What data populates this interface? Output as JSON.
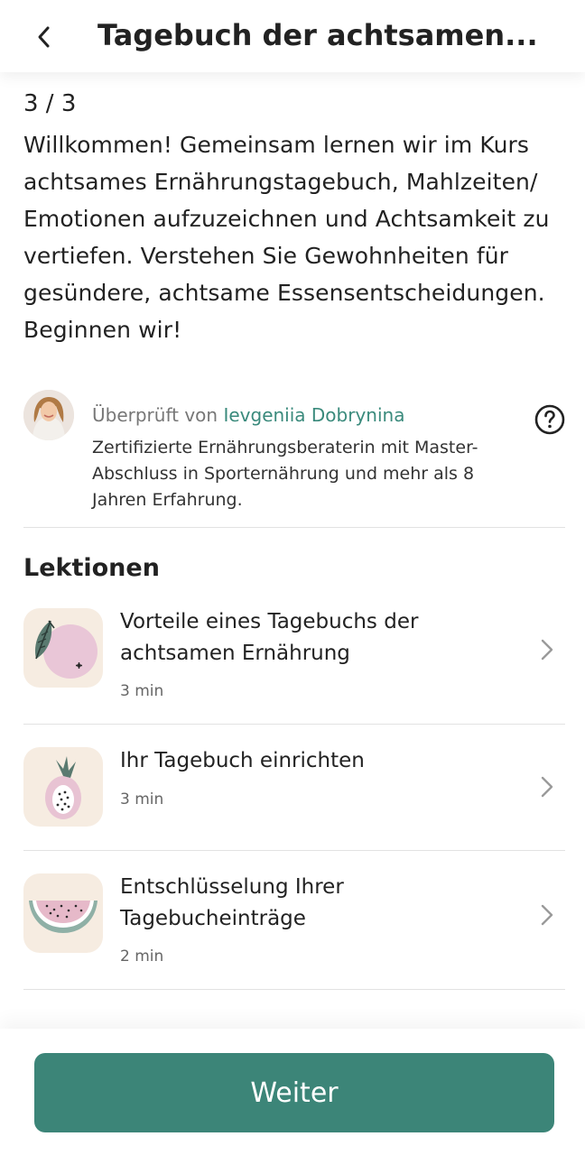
{
  "header": {
    "title": "Tagebuch der achtsamen...",
    "back_icon": "chevron-left-icon"
  },
  "course": {
    "counter": "3 / 3",
    "intro": "Willkommen! Gemeinsam lernen wir im Kurs achtsames Ernährungstagebuch, Mahlzeiten/ Emotionen aufzuzeichnen und Achtsamkeit zu vertiefen. Verstehen Sie Gewohnheiten für gesündere, achtsame Essensentscheidungen. Beginnen wir!"
  },
  "reviewer": {
    "prefix": "Überprüft von",
    "name": "Ievgeniia Dobrynina",
    "description": "Zertifizierte Ernährungsberaterin mit Master-Abschluss in Sporternährung und mehr als 8 Jahren Erfahrung.",
    "help_icon": "question-circle-icon"
  },
  "lessons": {
    "heading": "Lektionen",
    "items": [
      {
        "title": "Vorteile eines Tagebuchs der achtsamen Ernährung",
        "duration": "3 min",
        "icon": "apple-leaf-icon"
      },
      {
        "title": "Ihr Tagebuch einrichten",
        "duration": "3 min",
        "icon": "dragonfruit-icon"
      },
      {
        "title": "Entschlüsselung Ihrer Tagebucheinträge",
        "duration": "2 min",
        "icon": "watermelon-icon"
      }
    ]
  },
  "footer": {
    "continue_label": "Weiter"
  },
  "colors": {
    "accent": "#3c8578",
    "link": "#3a8a7c",
    "icon_background": "#f6ece1"
  }
}
